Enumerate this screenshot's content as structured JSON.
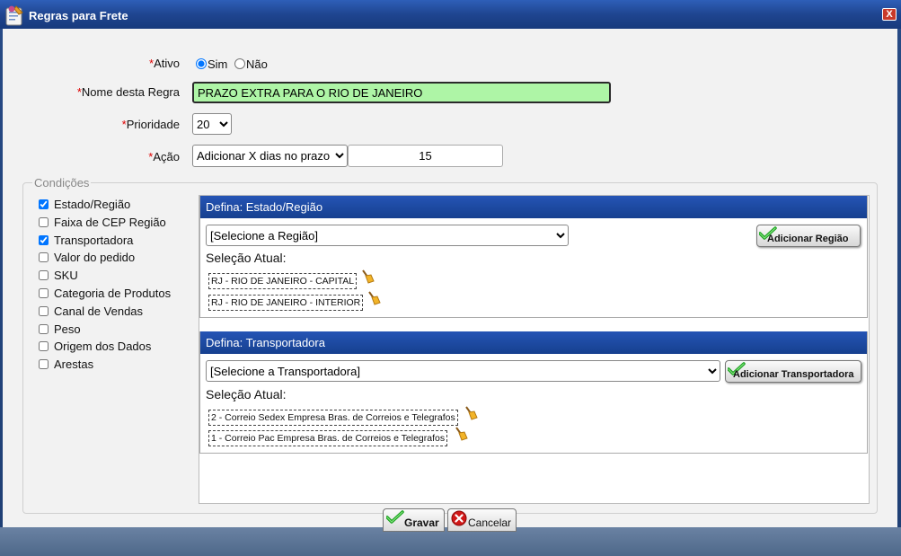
{
  "window": {
    "title": "Regras para Frete",
    "close_glyph": "X"
  },
  "form": {
    "ativo": {
      "label": "Ativo",
      "options": [
        "Sim",
        "Não"
      ],
      "selected": "Sim"
    },
    "nome": {
      "label": "Nome desta Regra",
      "value": "PRAZO EXTRA PARA O RIO DE JANEIRO"
    },
    "prioridade": {
      "label": "Prioridade",
      "value": "20"
    },
    "acao": {
      "label": "Ação",
      "value": "Adicionar X dias no prazo",
      "days": "15"
    },
    "required_mark": "*"
  },
  "conditions": {
    "legend": "Condições",
    "items": [
      {
        "label": "Estado/Região",
        "checked": true
      },
      {
        "label": "Faixa de CEP Região",
        "checked": false
      },
      {
        "label": "Transportadora",
        "checked": true
      },
      {
        "label": "Valor do pedido",
        "checked": false
      },
      {
        "label": "SKU",
        "checked": false
      },
      {
        "label": "Categoria de Produtos",
        "checked": false
      },
      {
        "label": "Canal de Vendas",
        "checked": false
      },
      {
        "label": "Peso",
        "checked": false
      },
      {
        "label": "Origem dos Dados",
        "checked": false
      },
      {
        "label": "Arestas",
        "checked": false
      }
    ]
  },
  "sections": {
    "regiao": {
      "title": "Defina: Estado/Região",
      "select_value": "[Selecione a Região]",
      "add_label": "Adicionar Região",
      "current_label": "Seleção Atual:",
      "selected": [
        "RJ - RIO DE JANEIRO - CAPITAL",
        "RJ - RIO DE JANEIRO - INTERIOR"
      ]
    },
    "transportadora": {
      "title": "Defina: Transportadora",
      "select_value": "[Selecione a Transportadora]",
      "add_label": "Adicionar Transportadora",
      "current_label": "Seleção Atual:",
      "selected": [
        "2 - Correio Sedex Empresa Bras. de Correios e Telegrafos",
        "1 - Correio Pac Empresa Bras. de Correios e Telegrafos"
      ]
    }
  },
  "footer": {
    "save_label": "Gravar",
    "cancel_label": "Cancelar"
  },
  "icons": {
    "title": "form-edit-icon",
    "add": "green-check-icon",
    "remove": "broom-icon",
    "save": "green-check-icon",
    "cancel": "red-cancel-icon"
  },
  "colors": {
    "title_bar": "#1f4590",
    "section_header": "#1e4aa2",
    "name_field_bg": "#aef5a6",
    "required": "#dd0000"
  }
}
